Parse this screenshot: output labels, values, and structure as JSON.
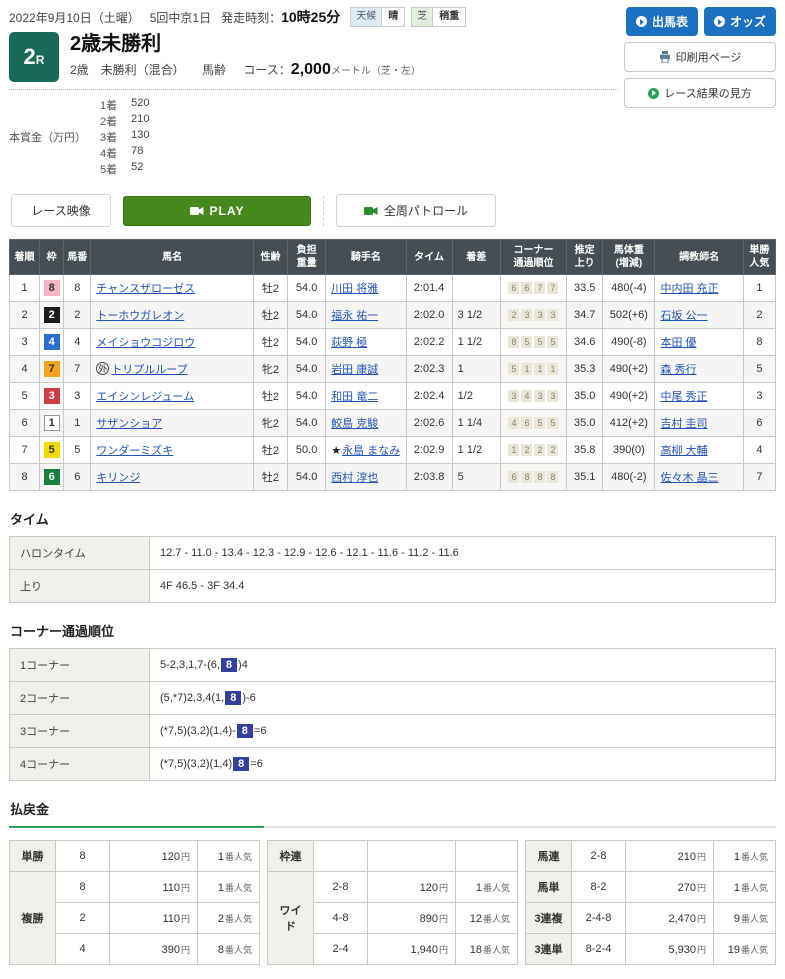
{
  "header": {
    "date": "2022年9月10日（土曜）",
    "meeting": "5回中京1日",
    "start_label": "発走時刻：",
    "start_time": "10時25分",
    "weather_label": "天候",
    "weather_value": "晴",
    "turf_label": "芝",
    "turf_value": "稍重",
    "btn_entry": "出馬表",
    "btn_odds": "オッズ",
    "btn_print": "印刷用ページ",
    "btn_howto": "レース結果の見方"
  },
  "race": {
    "number": "2",
    "number_suffix": "R",
    "title": "2歳未勝利",
    "conditions": "2歳　未勝利（混合）",
    "age_rule": "馬齢",
    "course_label": "コース：",
    "course_value": "2,000",
    "course_unit": "メートル（芝・左）"
  },
  "prize": {
    "label": "本賞金（万円）",
    "items": [
      {
        "rank": "1着",
        "amount": "520"
      },
      {
        "rank": "2着",
        "amount": "210"
      },
      {
        "rank": "3着",
        "amount": "130"
      },
      {
        "rank": "4着",
        "amount": "78"
      },
      {
        "rank": "5着",
        "amount": "52"
      }
    ]
  },
  "video": {
    "race_video": "レース映像",
    "play": "PLAY",
    "patrol": "全周パトロール"
  },
  "results": {
    "headers": [
      "着順",
      "枠",
      "馬番",
      "馬名",
      "性齢",
      "負担\n重量",
      "騎手名",
      "タイム",
      "着差",
      "コーナー\n通過順位",
      "推定\n上り",
      "馬体重\n(増減)",
      "調教師名",
      "単勝\n人気"
    ],
    "rows": [
      {
        "pos": "1",
        "waku": "8",
        "num": "8",
        "mark": "",
        "horse": "チャンスザローゼス",
        "sexage": "牡2",
        "weight": "54.0",
        "jockey_mark": "",
        "jockey": "川田 将雅",
        "time": "2:01.4",
        "margin": "",
        "corners": [
          "6",
          "6",
          "7",
          "7"
        ],
        "agari": "33.5",
        "body_weight": "480(-4)",
        "trainer": "中内田 充正",
        "pop": "1"
      },
      {
        "pos": "2",
        "waku": "2",
        "num": "2",
        "mark": "",
        "horse": "トーホウガレオン",
        "sexage": "牡2",
        "weight": "54.0",
        "jockey_mark": "",
        "jockey": "福永 祐一",
        "time": "2:02.0",
        "margin": "3 1/2",
        "corners": [
          "2",
          "3",
          "3",
          "3"
        ],
        "agari": "34.7",
        "body_weight": "502(+6)",
        "trainer": "石坂 公一",
        "pop": "2"
      },
      {
        "pos": "3",
        "waku": "4",
        "num": "4",
        "mark": "",
        "horse": "メイショウコジロウ",
        "sexage": "牡2",
        "weight": "54.0",
        "jockey_mark": "",
        "jockey": "荻野 極",
        "time": "2:02.2",
        "margin": "1 1/2",
        "corners": [
          "8",
          "5",
          "5",
          "5"
        ],
        "agari": "34.6",
        "body_weight": "490(-8)",
        "trainer": "本田 優",
        "pop": "8"
      },
      {
        "pos": "4",
        "waku": "7",
        "num": "7",
        "mark": "外",
        "horse": "トリプルループ",
        "sexage": "牝2",
        "weight": "54.0",
        "jockey_mark": "",
        "jockey": "岩田 康誠",
        "time": "2:02.3",
        "margin": "1",
        "corners": [
          "5",
          "1",
          "1",
          "1"
        ],
        "agari": "35.3",
        "body_weight": "490(+2)",
        "trainer": "森 秀行",
        "pop": "5"
      },
      {
        "pos": "5",
        "waku": "3",
        "num": "3",
        "mark": "",
        "horse": "エイシンレジューム",
        "sexage": "牡2",
        "weight": "54.0",
        "jockey_mark": "",
        "jockey": "和田 竜二",
        "time": "2:02.4",
        "margin": "1/2",
        "corners": [
          "3",
          "4",
          "3",
          "3"
        ],
        "agari": "35.0",
        "body_weight": "490(+2)",
        "trainer": "中尾 秀正",
        "pop": "3"
      },
      {
        "pos": "6",
        "waku": "1",
        "num": "1",
        "mark": "",
        "horse": "サザンショア",
        "sexage": "牝2",
        "weight": "54.0",
        "jockey_mark": "",
        "jockey": "鮫島 克駿",
        "time": "2:02.6",
        "margin": "1 1/4",
        "corners": [
          "4",
          "6",
          "5",
          "5"
        ],
        "agari": "35.0",
        "body_weight": "412(+2)",
        "trainer": "吉村 圭司",
        "pop": "6"
      },
      {
        "pos": "7",
        "waku": "5",
        "num": "5",
        "mark": "",
        "horse": "ワンダーミズキ",
        "sexage": "牡2",
        "weight": "50.0",
        "jockey_mark": "★",
        "jockey": "永島 まなみ",
        "time": "2:02.9",
        "margin": "1 1/2",
        "corners": [
          "1",
          "2",
          "2",
          "2"
        ],
        "agari": "35.8",
        "body_weight": "390(0)",
        "trainer": "高柳 大輔",
        "pop": "4"
      },
      {
        "pos": "8",
        "waku": "6",
        "num": "6",
        "mark": "",
        "horse": "キリンジ",
        "sexage": "牡2",
        "weight": "54.0",
        "jockey_mark": "",
        "jockey": "西村 淳也",
        "time": "2:03.8",
        "margin": "5",
        "corners": [
          "6",
          "8",
          "8",
          "8"
        ],
        "agari": "35.1",
        "body_weight": "480(-2)",
        "trainer": "佐々木 晶三",
        "pop": "7"
      }
    ]
  },
  "time_section": {
    "title": "タイム",
    "rows": [
      {
        "label": "ハロンタイム",
        "value": "12.7 - 11.0 - 13.4 - 12.3 - 12.9 - 12.6 - 12.1 - 11.6 - 11.2 - 11.6"
      },
      {
        "label": "上り",
        "value": "4F 46.5 - 3F 34.4"
      }
    ]
  },
  "corner_order": {
    "title": "コーナー通過順位",
    "rows": [
      {
        "label": "1コーナー",
        "before": "5-2,3,1,7-(6,",
        "highlight": "8",
        "after": ")4"
      },
      {
        "label": "2コーナー",
        "before": "(5,*7)2,3,4(1,",
        "highlight": "8",
        "after": ")-6"
      },
      {
        "label": "3コーナー",
        "before": "(*7,5)(3,2)(1,4)-",
        "highlight": "8",
        "after": "=6"
      },
      {
        "label": "4コーナー",
        "before": "(*7,5)(3,2)(1,4)",
        "highlight": "8",
        "after": "=6"
      }
    ]
  },
  "payout": {
    "title": "払戻金",
    "unit_yen": "円",
    "pop_suffix": "番人気",
    "tables": [
      {
        "groups": [
          {
            "label": "単勝",
            "rows": [
              {
                "comb": "8",
                "amount": "120",
                "pop": "1"
              }
            ]
          },
          {
            "label": "複勝",
            "rows": [
              {
                "comb": "8",
                "amount": "110",
                "pop": "1"
              },
              {
                "comb": "2",
                "amount": "110",
                "pop": "2"
              },
              {
                "comb": "4",
                "amount": "390",
                "pop": "8"
              }
            ]
          }
        ]
      },
      {
        "groups": [
          {
            "label": "枠連",
            "rows": [
              {
                "comb": "",
                "amount": "",
                "pop": ""
              }
            ]
          },
          {
            "label": "ワイド",
            "rows": [
              {
                "comb": "2-8",
                "amount": "120",
                "pop": "1"
              },
              {
                "comb": "4-8",
                "amount": "890",
                "pop": "12"
              },
              {
                "comb": "2-4",
                "amount": "1,940",
                "pop": "18"
              }
            ]
          }
        ]
      },
      {
        "groups": [
          {
            "label": "馬連",
            "rows": [
              {
                "comb": "2-8",
                "amount": "210",
                "pop": "1"
              }
            ]
          },
          {
            "label": "馬単",
            "rows": [
              {
                "comb": "8-2",
                "amount": "270",
                "pop": "1"
              }
            ]
          },
          {
            "label": "3連複",
            "rows": [
              {
                "comb": "2-4-8",
                "amount": "2,470",
                "pop": "9"
              }
            ]
          },
          {
            "label": "3連単",
            "rows": [
              {
                "comb": "8-2-4",
                "amount": "5,930",
                "pop": "19"
              }
            ]
          }
        ]
      }
    ]
  }
}
